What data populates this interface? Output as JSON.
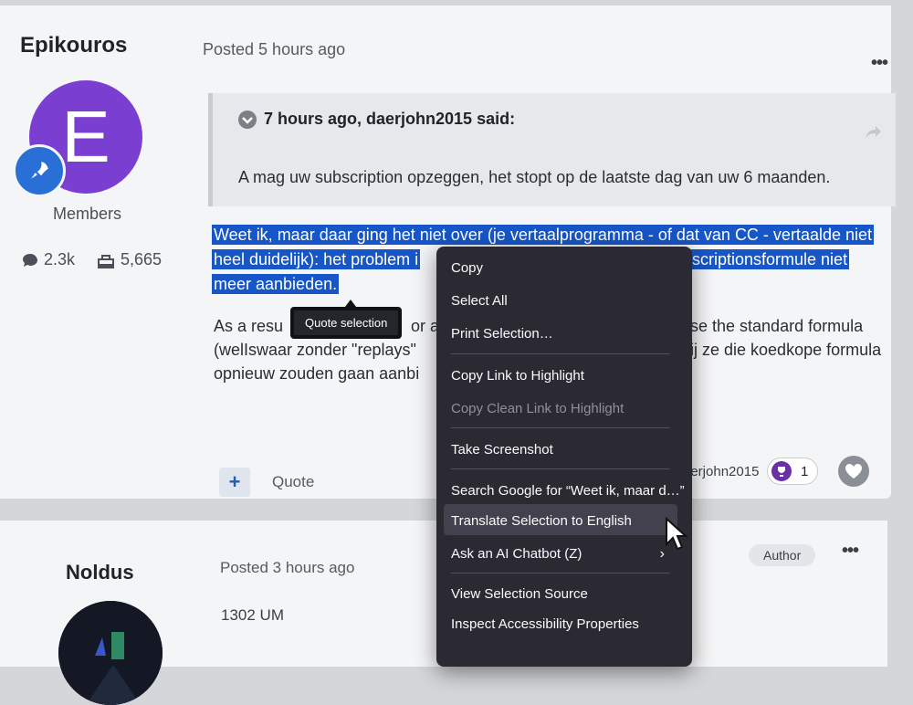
{
  "post1": {
    "author": "Epikouros",
    "posted": "Posted 5 hours ago",
    "avatar_letter": "E",
    "group": "Members",
    "stats": [
      {
        "icon": "comment-icon",
        "value": "2.3k"
      },
      {
        "icon": "reputation-icon",
        "value": "5,665"
      }
    ],
    "quote": {
      "header": "7 hours ago, daerjohn2015 said:",
      "text": "A mag uw subscription opzeggen, het stopt op de laatste dag van uw 6 maanden."
    },
    "selected_lines": [
      "Weet ik, maar daar ging het niet over (je vertaalprogramma - of dat van CC - vertaalde niet",
      "heel duidelijk): het problem i",
      "scriptionsformule niet",
      "meer aanbieden."
    ],
    "body_lines": [
      "As a resu",
      "or a",
      "se the standard formula",
      "(welIswaar zonder \"replays\"",
      "ij ze die koedkope formula",
      "opnieuw zouden gaan aanbi"
    ],
    "quote_selection_label": "Quote selection",
    "footer": {
      "plus": "+",
      "quote_label": "Quote",
      "reacted_by": "aerjohn2015",
      "reaction_count": "1"
    }
  },
  "post2": {
    "author": "Noldus",
    "posted": "Posted 3 hours ago",
    "badge": "Author",
    "text": "1302 UM"
  },
  "menu": {
    "items": [
      {
        "label": "Copy",
        "state": "normal"
      },
      {
        "label": "Select All",
        "state": "normal"
      },
      {
        "label": "Print Selection…",
        "state": "normal"
      },
      {
        "label": "Copy Link to Highlight",
        "state": "normal"
      },
      {
        "label": "Copy Clean Link to Highlight",
        "state": "disabled"
      },
      {
        "label": "Take Screenshot",
        "state": "normal"
      },
      {
        "label": "Search Google for “Weet ik, maar d…”",
        "state": "normal"
      },
      {
        "label": "Translate Selection to English",
        "state": "hover"
      },
      {
        "label": "Ask an AI Chatbot (Z)",
        "state": "normal"
      },
      {
        "label": "View Selection Source",
        "state": "normal"
      },
      {
        "label": "Inspect Accessibility Properties",
        "state": "normal"
      }
    ],
    "submenu_chevron": "›"
  },
  "colors": {
    "selection": "#1756c8",
    "avatar": "#7a3fd1",
    "menu_bg": "#2b2a33",
    "menu_hover": "#42414d"
  },
  "dots": "•••"
}
